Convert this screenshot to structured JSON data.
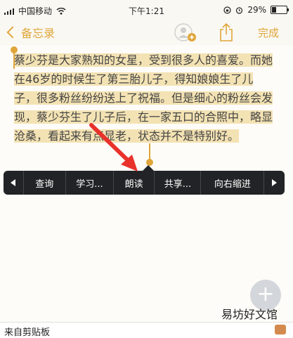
{
  "status_bar": {
    "carrier": "中国移动",
    "time": "下午1:21",
    "battery_percent": "29%",
    "battery_level": 0.29
  },
  "nav": {
    "back_label": "备忘录",
    "done_label": "完成"
  },
  "note": {
    "selected_text": "蔡少芬是大家熟知的女星，受到很多人的喜爱。而她在46岁的时候生了第三胎儿子，得知娘娘生了儿子，很多粉丝纷纷送上了祝福。但是细心的粉丝会发现，蔡少芬生了儿子后，在一家五口的合照中，略显沧桑，看起来有点显老，状态并不是特别好。"
  },
  "context_menu": {
    "items": [
      "查询",
      "学习...",
      "朗读",
      "共享...",
      "向右缩进"
    ]
  },
  "watermark": "易坊好文馆",
  "clipboard_bar": {
    "label": "来自剪贴板"
  },
  "colors": {
    "accent": "#e0a63a",
    "selection": "#f3e2b3",
    "menu_bg": "#222326",
    "annotation_arrow": "#e8322b"
  }
}
